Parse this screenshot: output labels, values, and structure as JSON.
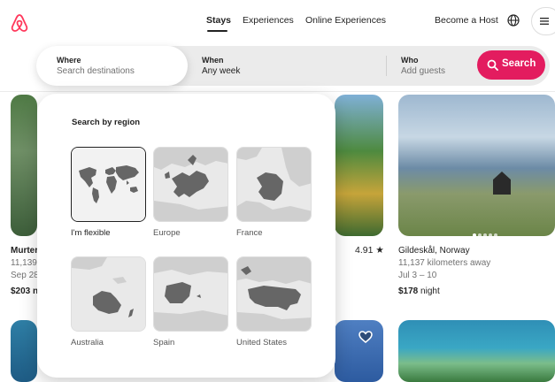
{
  "header": {
    "nav": {
      "stays": "Stays",
      "experiences": "Experiences",
      "online": "Online Experiences"
    },
    "become_host": "Become a Host",
    "brand_color": "#ff385c"
  },
  "search": {
    "where": {
      "label": "Where",
      "placeholder": "Search destinations"
    },
    "when": {
      "label": "When",
      "value": "Any week"
    },
    "who": {
      "label": "Who",
      "placeholder": "Add guests"
    },
    "button": "Search",
    "button_color": "#e31c5f"
  },
  "regions": {
    "title": "Search by region",
    "items": [
      {
        "label": "I'm flexible",
        "selected": true
      },
      {
        "label": "Europe",
        "selected": false
      },
      {
        "label": "France",
        "selected": false
      },
      {
        "label": "Australia",
        "selected": false
      },
      {
        "label": "Spain",
        "selected": false
      },
      {
        "label": "United States",
        "selected": false
      }
    ]
  },
  "listings": {
    "left": {
      "title": "Murter",
      "distance": "11,139 k",
      "dates": "Sep 28",
      "price": "$203 n"
    },
    "middle": {
      "rating": "4.91 ★"
    },
    "right": {
      "title": "Gildeskål, Norway",
      "distance": "11,137 kilometers away",
      "dates": "Jul 3 – 10",
      "price": "$178",
      "price_unit": "night"
    }
  }
}
